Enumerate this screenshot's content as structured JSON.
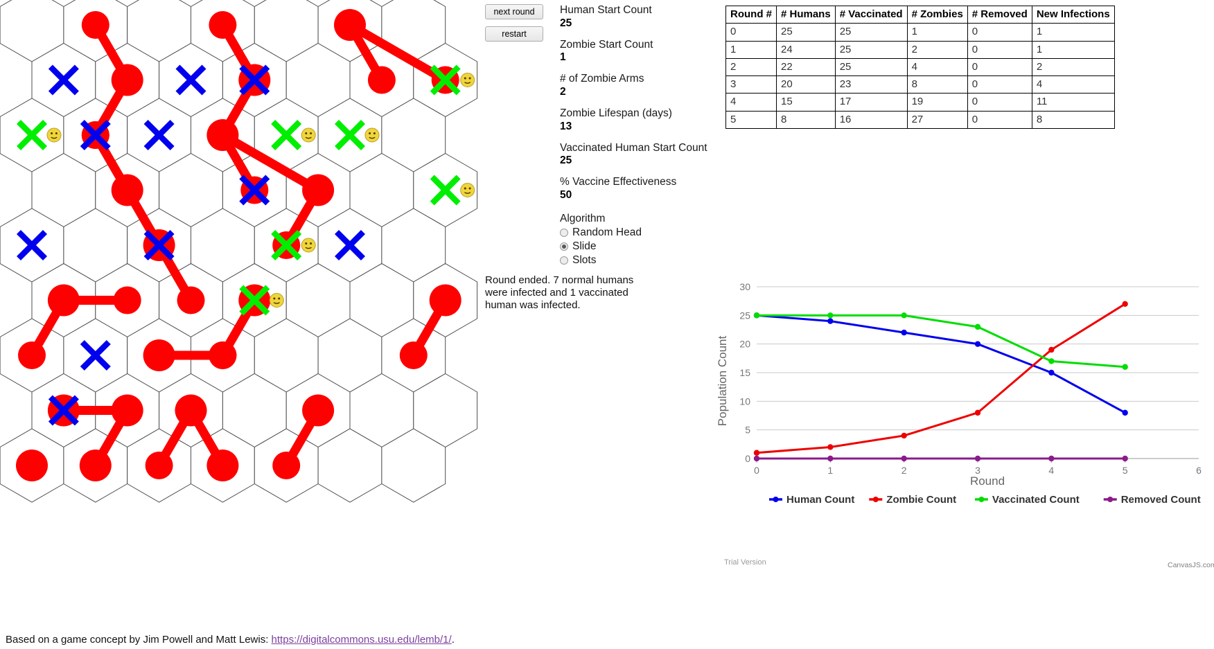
{
  "buttons": {
    "next_round": "next round",
    "restart": "restart"
  },
  "params": [
    {
      "label": "Human Start Count",
      "value": "25"
    },
    {
      "label": "Zombie Start Count",
      "value": "1"
    },
    {
      "label": "# of Zombie Arms",
      "value": "2"
    },
    {
      "label": "Zombie Lifespan (days)",
      "value": "13"
    },
    {
      "label": "Vaccinated Human Start Count",
      "value": "25"
    },
    {
      "label": "% Vaccine Effectiveness",
      "value": "50"
    }
  ],
  "algorithm": {
    "title": "Algorithm",
    "options": [
      {
        "label": "Random Head",
        "selected": false
      },
      {
        "label": "Slide",
        "selected": true
      },
      {
        "label": "Slots",
        "selected": false
      }
    ]
  },
  "status": "Round ended. 7 normal humans were infected and 1 vaccinated human was infected.",
  "table": {
    "headers": [
      "Round #",
      "# Humans",
      "# Vaccinated",
      "# Zombies",
      "# Removed",
      "New Infections"
    ],
    "rows": [
      [
        "0",
        "25",
        "25",
        "1",
        "0",
        "1"
      ],
      [
        "1",
        "24",
        "25",
        "2",
        "0",
        "1"
      ],
      [
        "2",
        "22",
        "25",
        "4",
        "0",
        "2"
      ],
      [
        "3",
        "20",
        "23",
        "8",
        "0",
        "4"
      ],
      [
        "4",
        "15",
        "17",
        "19",
        "0",
        "11"
      ],
      [
        "5",
        "8",
        "16",
        "27",
        "0",
        "8"
      ]
    ]
  },
  "chart_data": {
    "type": "line",
    "title": "",
    "xlabel": "Round",
    "ylabel": "Population Count",
    "x": [
      0,
      1,
      2,
      3,
      4,
      5
    ],
    "xlim": [
      0,
      6
    ],
    "ylim": [
      0,
      30
    ],
    "xticks": [
      "0",
      "1",
      "2",
      "3",
      "4",
      "5",
      "6"
    ],
    "yticks": [
      "0",
      "5",
      "10",
      "15",
      "20",
      "25",
      "30"
    ],
    "grid": true,
    "legend_position": "bottom",
    "series": [
      {
        "name": "Human Count",
        "color": "#0000ee",
        "values": [
          25,
          24,
          22,
          20,
          15,
          8
        ]
      },
      {
        "name": "Zombie Count",
        "color": "#ee0000",
        "values": [
          1,
          2,
          4,
          8,
          19,
          27
        ]
      },
      {
        "name": "Vaccinated Count",
        "color": "#00dd00",
        "values": [
          25,
          25,
          25,
          23,
          17,
          16
        ]
      },
      {
        "name": "Removed Count",
        "color": "#8b1a8b",
        "values": [
          0,
          0,
          0,
          0,
          0,
          0
        ]
      }
    ],
    "watermark": "Trial Version",
    "credit": "CanvasJS.com"
  },
  "board": {
    "cols": 7,
    "rows": 9,
    "colors": {
      "hex_stroke": "#4d4d4d",
      "zombie": "#ff0000",
      "human": "#0000ee",
      "vaccinated": "#00ee00",
      "smiley": "#f0d43c"
    },
    "markers": [
      {
        "type": "human-x",
        "col": 0,
        "row": 1
      },
      {
        "type": "human-x",
        "col": 0,
        "row": 4
      },
      {
        "type": "human-x",
        "col": 0,
        "row": 7
      },
      {
        "type": "vacc-x",
        "col": 0,
        "row": 2
      },
      {
        "type": "human-x",
        "col": 1,
        "row": 2
      },
      {
        "type": "human-x",
        "col": 1,
        "row": 6
      },
      {
        "type": "human-x",
        "col": 2,
        "row": 1
      },
      {
        "type": "human-x",
        "col": 2,
        "row": 2
      },
      {
        "type": "human-x",
        "col": 2,
        "row": 4
      },
      {
        "type": "human-x",
        "col": 3,
        "row": 1
      },
      {
        "type": "human-x",
        "col": 3,
        "row": 3
      },
      {
        "type": "vacc-x",
        "col": 3,
        "row": 5
      },
      {
        "type": "vacc-x",
        "col": 4,
        "row": 2
      },
      {
        "type": "vacc-x",
        "col": 4,
        "row": 4
      },
      {
        "type": "human-x",
        "col": 5,
        "row": 4
      },
      {
        "type": "vacc-x",
        "col": 5,
        "row": 2
      },
      {
        "type": "vacc-x",
        "col": 6,
        "row": 1
      },
      {
        "type": "vacc-x",
        "col": 6,
        "row": 3
      }
    ]
  },
  "footer": {
    "text_before": "Based on a game concept by Jim Powell and Matt Lewis: ",
    "link": "https://digitalcommons.usu.edu/lemb/1/",
    "text_after": "."
  }
}
